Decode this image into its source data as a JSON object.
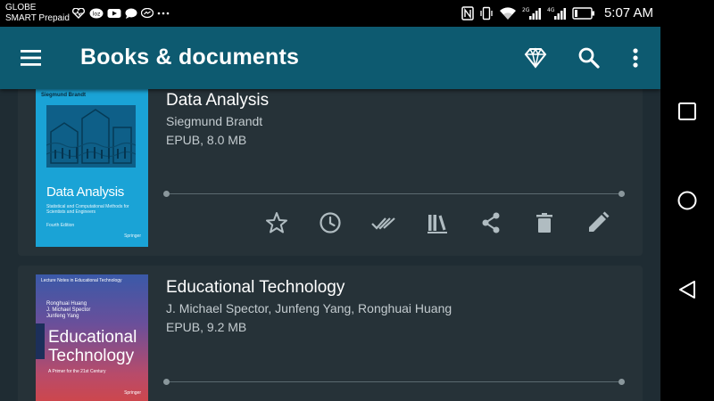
{
  "statusbar": {
    "carrier_line1": "GLOBE",
    "carrier_line2": "SMART Prepaid",
    "time": "5:07 AM",
    "icons_left": [
      "heart-monitor-icon",
      "lte-badge-icon",
      "youtube-icon",
      "chat-bubble-icon",
      "messenger-icon",
      "more-notifications-icon"
    ],
    "icons_right": [
      "nfc-icon",
      "vibrate-icon",
      "wifi-icon",
      "signal-2g-icon",
      "signal-4g-icon",
      "battery-icon"
    ],
    "net_labels": [
      "2G",
      "4G"
    ]
  },
  "appbar": {
    "title": "Books & documents",
    "icons": [
      "menu-icon",
      "diamond-icon",
      "search-icon",
      "more-vert-icon"
    ]
  },
  "books": [
    {
      "title": "Data Analysis",
      "author": "Siegmund Brandt",
      "meta": "EPUB, 8.0 MB",
      "cover": {
        "author": "Siegmund Brandt",
        "title": "Data Analysis",
        "subtitle": "Statistical and Computational Methods for Scientists and Engineers",
        "edition": "Fourth Edition",
        "publisher": "Springer",
        "color": "#1aa3d6"
      },
      "actions": [
        "star-icon",
        "history-icon",
        "done-all-icon",
        "library-icon",
        "share-icon",
        "delete-icon",
        "edit-icon"
      ]
    },
    {
      "title": "Educational Technology",
      "author": "J. Michael Spector, Junfeng Yang, Ronghuai Huang",
      "meta": "EPUB, 9.2 MB",
      "cover": {
        "series": "Lecture Notes in Educational Technology",
        "authors": [
          "Ronghuai Huang",
          "J. Michael Spector",
          "Junfeng Yang"
        ],
        "title_line1": "Educational",
        "title_line2": "Technology",
        "subtitle": "A Primer for the 21st Century",
        "publisher": "Springer"
      }
    }
  ],
  "navbar": {
    "buttons": [
      "recents-square-icon",
      "home-circle-icon",
      "back-triangle-icon"
    ]
  },
  "colors": {
    "appbar": "#0d5a70",
    "background": "#1f2c33",
    "card": "#263238",
    "icon": "#b0bcc1"
  }
}
